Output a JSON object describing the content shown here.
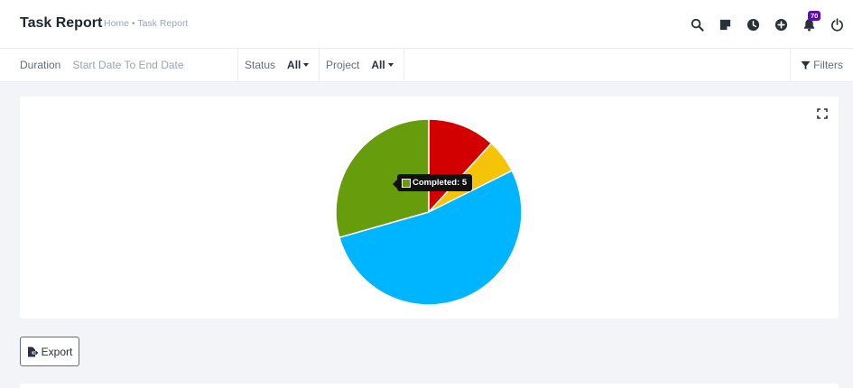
{
  "header": {
    "title": "Task Report",
    "breadcrumb": "Home • Task Report",
    "notification_count": "70",
    "icons": [
      "search-icon",
      "sticky-note-icon",
      "clock-icon",
      "plus-circle-icon",
      "bell-icon",
      "power-icon"
    ]
  },
  "filters": {
    "duration_label": "Duration",
    "duration_placeholder": "Start Date To End Date",
    "status_label": "Status",
    "status_value": "All",
    "project_label": "Project",
    "project_value": "All",
    "filters_label": "Filters"
  },
  "chart_data": {
    "type": "pie",
    "slices": [
      {
        "name": "",
        "value": 2,
        "color": "#d30000"
      },
      {
        "name": "",
        "value": 1,
        "color": "#f5c308"
      },
      {
        "name": "",
        "value": 9,
        "color": "#00b5ff"
      },
      {
        "name": "Completed",
        "value": 5,
        "color": "#679c0d"
      }
    ],
    "tooltip": {
      "label": "Completed: 5",
      "color": "#679c0d"
    }
  },
  "actions": {
    "export_label": "Export"
  }
}
